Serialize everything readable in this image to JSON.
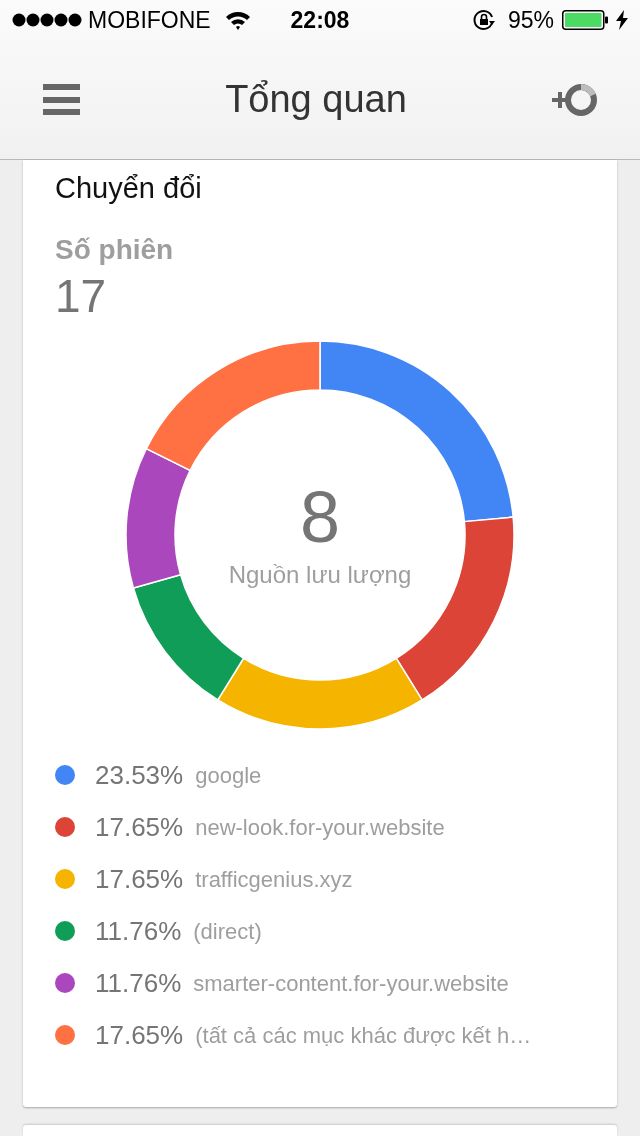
{
  "status_bar": {
    "carrier": "MOBIFONE",
    "time": "22:08",
    "battery": "95%"
  },
  "nav": {
    "title": "Tổng quan"
  },
  "card": {
    "title": "Chuyển đổi",
    "metric_label": "Số phiên",
    "metric_value": "17",
    "chart": {
      "center_value": "8",
      "center_label": "Nguồn lưu lượng",
      "chart_data": {
        "type": "donut",
        "categories": [
          "google",
          "new-look.for-your.website",
          "trafficgenius.xyz",
          "(direct)",
          "smarter-content.for-your.website",
          "(tất cả các mục khác được kết h…"
        ],
        "values": [
          23.53,
          17.65,
          17.65,
          11.76,
          11.76,
          17.65
        ]
      }
    },
    "legend": [
      {
        "color": "#4285f4",
        "percent": "23.53%"
      },
      {
        "color": "#db4437",
        "percent": "17.65%"
      },
      {
        "color": "#f4b400",
        "percent": "17.65%"
      },
      {
        "color": "#0f9d58",
        "percent": "11.76%"
      },
      {
        "color": "#ab47bc",
        "percent": "11.76%"
      },
      {
        "color": "#ff7043",
        "percent": "17.65%"
      }
    ]
  }
}
